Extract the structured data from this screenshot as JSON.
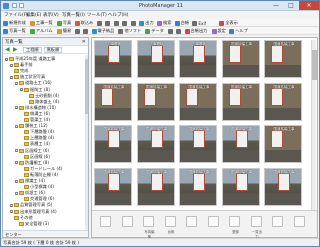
{
  "window": {
    "title": "PhotoManager 11",
    "minimize": "—",
    "maximize": "□",
    "close": "✕"
  },
  "menu": [
    "ファイル(F)",
    "編集(E)",
    "表示(V)",
    "写真一覧(I)",
    "ツール(T)",
    "ヘルプ(H)"
  ],
  "toolbar1": [
    {
      "label": "新規作成",
      "color": "#3c7fd0"
    },
    {
      "label": "工事一覧",
      "color": "#d49a2a"
    },
    {
      "label": "写真",
      "color": "#4aa24a"
    },
    {
      "label": "取込み",
      "color": "#d05a3c"
    },
    {
      "label": "",
      "color": "#6c6c6c"
    },
    {
      "label": "",
      "color": "#6c6c6c"
    },
    {
      "label": "",
      "color": "#6c6c6c"
    },
    {
      "label": "",
      "color": "#6c6c6c"
    },
    {
      "label": "",
      "color": "#6c6c6c"
    },
    {
      "label": "出力",
      "color": "#2f8fbf"
    },
    {
      "label": "検索",
      "color": "#9c6ac1"
    },
    {
      "label": "台帳",
      "color": "#3c7fd0"
    },
    {
      "label": "Exif",
      "color": "#6c6c6c"
    },
    {
      "label": "全表示",
      "color": "#c94a4a"
    }
  ],
  "toolbar2": [
    {
      "label": "写真一覧",
      "color": "#3c7fd0"
    },
    {
      "label": "アルバム",
      "color": "#4aa24a"
    },
    {
      "label": "簡易",
      "color": "#d49a2a"
    },
    {
      "label": "",
      "color": "#6c6c6c"
    },
    {
      "label": "",
      "color": "#6c6c6c"
    },
    {
      "label": "電子納品",
      "color": "#2f8fbf"
    },
    {
      "label": "他ソフト",
      "color": "#6c6c6c"
    },
    {
      "label": "データ",
      "color": "#4aa24a"
    },
    {
      "label": "",
      "color": "#6c6c6c"
    },
    {
      "label": "",
      "color": "#6c6c6c"
    },
    {
      "label": "台帳出力",
      "color": "#c94a4a"
    },
    {
      "label": "設定",
      "color": "#9c6ac1"
    },
    {
      "label": "ヘルプ",
      "color": "#3c7fd0"
    }
  ],
  "left_panel": {
    "header": "写真一覧",
    "close_icon": "✕",
    "prev_label": "",
    "next_label": "",
    "btn_a": "工程順",
    "btn_b": "黒板順",
    "footer": "センター"
  },
  "tree": [
    {
      "label": "平成25年度 道路工事",
      "depth": 0,
      "exp": "-"
    },
    {
      "label": "着手前",
      "depth": 1,
      "exp": "-"
    },
    {
      "label": "完成",
      "depth": 1,
      "exp": ""
    },
    {
      "label": "施工状況写真",
      "depth": 1,
      "exp": "-"
    },
    {
      "label": "道路土工 (16)",
      "depth": 2,
      "exp": "-"
    },
    {
      "label": "掘削工 (8)",
      "depth": 3,
      "exp": "-"
    },
    {
      "label": "土砂掘削 (4)",
      "depth": 4,
      "exp": ""
    },
    {
      "label": "路体盛土 (4)",
      "depth": 4,
      "exp": ""
    },
    {
      "label": "排水構造物 (10)",
      "depth": 2,
      "exp": "-"
    },
    {
      "label": "側溝工 (6)",
      "depth": 3,
      "exp": ""
    },
    {
      "label": "管渠工 (4)",
      "depth": 3,
      "exp": ""
    },
    {
      "label": "舗装工 (12)",
      "depth": 2,
      "exp": "-"
    },
    {
      "label": "下層路盤 (4)",
      "depth": 3,
      "exp": ""
    },
    {
      "label": "上層路盤 (4)",
      "depth": 3,
      "exp": ""
    },
    {
      "label": "表層工 (4)",
      "depth": 3,
      "exp": ""
    },
    {
      "label": "区画線工 (6)",
      "depth": 2,
      "exp": "-"
    },
    {
      "label": "区画線 (6)",
      "depth": 3,
      "exp": ""
    },
    {
      "label": "防護柵工 (8)",
      "depth": 2,
      "exp": "-"
    },
    {
      "label": "ガードレール (4)",
      "depth": 3,
      "exp": ""
    },
    {
      "label": "転落防止柵 (4)",
      "depth": 3,
      "exp": ""
    },
    {
      "label": "標識工 (4)",
      "depth": 2,
      "exp": "-"
    },
    {
      "label": "小型標識 (4)",
      "depth": 3,
      "exp": ""
    },
    {
      "label": "仮設工 (6)",
      "depth": 2,
      "exp": "-"
    },
    {
      "label": "交通管理 (6)",
      "depth": 3,
      "exp": ""
    },
    {
      "label": "品質管理写真 (5)",
      "depth": 1,
      "exp": "-"
    },
    {
      "label": "出来形管理写真 (4)",
      "depth": 1,
      "exp": "-"
    },
    {
      "label": "その他",
      "depth": 1,
      "exp": ""
    },
    {
      "label": "安全管理 (3)",
      "depth": 2,
      "exp": ""
    }
  ],
  "thumbnails": [
    {
      "caption": "工事看板",
      "board": true
    },
    {
      "caption": "工事看板",
      "board": true
    },
    {
      "caption": "工事看板",
      "board": true
    },
    {
      "caption": "国道拡幅工事",
      "board": false
    },
    {
      "caption": "国道拡幅工事",
      "board": false
    },
    {
      "caption": "国道拡幅工事",
      "board": false
    },
    {
      "caption": "国道拡幅工事",
      "board": false
    },
    {
      "caption": "国道拡幅工事",
      "board": false
    },
    {
      "caption": "国道拡幅工事",
      "board": false
    },
    {
      "caption": "国道拡幅工事",
      "board": false
    },
    {
      "caption": "国道拡幅工事",
      "board": true
    },
    {
      "caption": "国道拡幅工事",
      "board": true
    },
    {
      "caption": "国道拡幅工事",
      "board": true
    },
    {
      "caption": "国道拡幅工事",
      "board": true
    },
    {
      "caption": "国道拡幅工事",
      "board": false
    },
    {
      "caption": "国道拡幅工事",
      "board": true
    },
    {
      "caption": "国道拡幅工事",
      "board": true
    },
    {
      "caption": "国道拡幅工事",
      "board": true
    },
    {
      "caption": "国道拡幅工事",
      "board": true
    },
    {
      "caption": "国道拡幅工事",
      "board": true
    }
  ],
  "bottom_icons": [
    "",
    "",
    "写真編集",
    "台帳",
    "",
    "",
    "登録",
    "一覧出力",
    "",
    ""
  ],
  "status": "写真合計 59 枚 ( 下層 0 枚 合計 59 枚 )"
}
